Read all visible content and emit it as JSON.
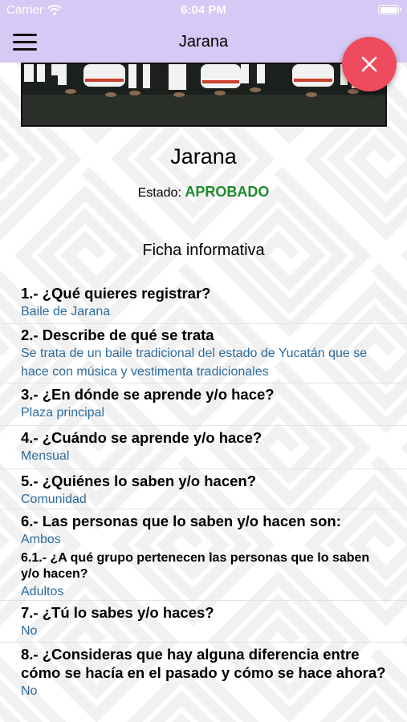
{
  "status_bar": {
    "carrier": "Carrier",
    "time": "6:04 PM"
  },
  "nav": {
    "title": "Jarana"
  },
  "record": {
    "title": "Jarana",
    "status_label": "Estado:",
    "status_value": "APROBADO",
    "section_title": "Ficha informativa"
  },
  "qa": [
    {
      "q": "1.- ¿Qué quieres registrar?",
      "a": "Baile de Jarana"
    },
    {
      "q": "2.- Describe de qué se trata",
      "a": "Se trata de un baile tradicional del estado de Yucatán que se hace con música y vestimenta tradicionales"
    },
    {
      "q": "3.- ¿En dónde se aprende y/o hace?",
      "a": "Plaza principal"
    },
    {
      "q": "4.- ¿Cuándo se aprende y/o hace?",
      "a": "Mensual"
    },
    {
      "q": "5.- ¿Quiénes lo saben y/o hacen?",
      "a": "Comunidad"
    },
    {
      "q": "6.- Las personas que lo saben y/o hacen son:",
      "a": "Ambos"
    },
    {
      "q": "6.1.- ¿A qué grupo pertenecen las personas que lo saben y/o hacen?",
      "a": "Adultos"
    },
    {
      "q": "7.- ¿Tú lo sabes y/o haces?",
      "a": "No"
    },
    {
      "q": "8.- ¿Consideras que hay alguna diferencia entre cómo se hacía en el pasado y cómo se hace ahora?",
      "a": "No"
    }
  ],
  "icons": {
    "menu": "hamburger-icon",
    "close": "close-icon",
    "wifi": "wifi-icon",
    "battery": "battery-icon"
  },
  "colors": {
    "nav_bg": "#d7c9f5",
    "fab": "#ee4b5f",
    "approved": "#1e8a2e",
    "answer": "#2d6b9c"
  }
}
